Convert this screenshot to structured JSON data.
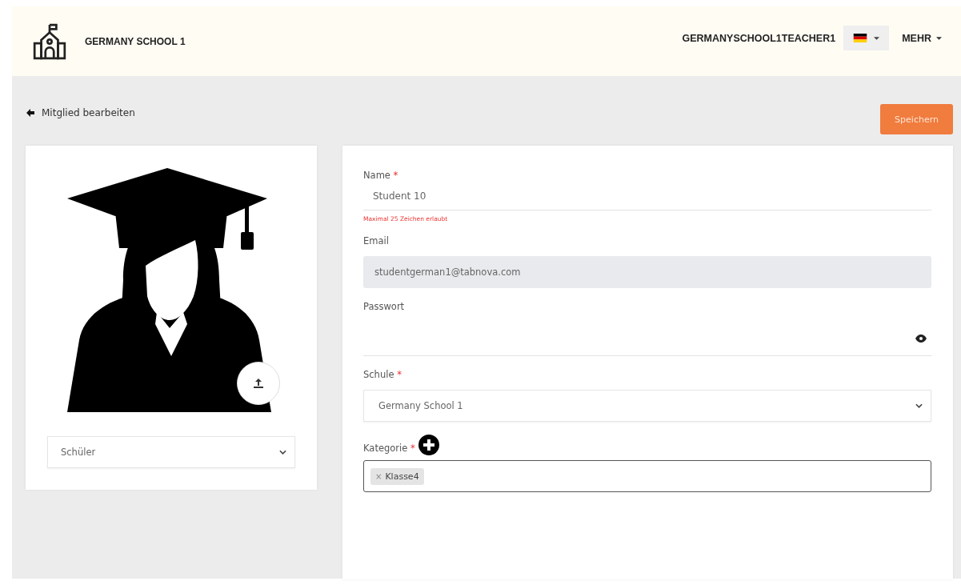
{
  "header": {
    "school_name": "GERMANY SCHOOL 1",
    "username": "GERMANYSCHOOL1TEACHER1",
    "more_menu": "MEHR"
  },
  "page": {
    "title": "Mitglied bearbeiten",
    "save_button": "Speichern"
  },
  "profile": {
    "role_select": "Schüler"
  },
  "form": {
    "name": {
      "label": "Name",
      "required_mark": "*",
      "value": "Student 10",
      "error": "Maximal 25 Zeichen erlaubt"
    },
    "email": {
      "label": "Email",
      "value": "studentgerman1@tabnova.com",
      "disabled": true
    },
    "password": {
      "label": "Passwort"
    },
    "school": {
      "label": "Schule",
      "required_mark": "*",
      "value": "Germany School 1"
    },
    "category": {
      "label": "Kategorie",
      "required_mark": "*",
      "tags": [
        {
          "remove": "×",
          "label": "Klasse4"
        }
      ]
    }
  }
}
